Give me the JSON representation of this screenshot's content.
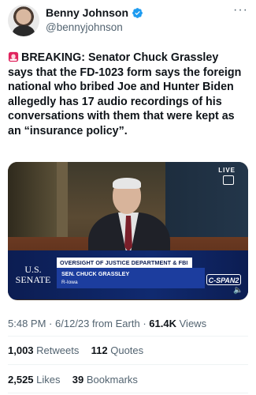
{
  "author": {
    "display_name": "Benny Johnson",
    "handle": "@bennyjohnson",
    "verified_color": "#1d9bf0"
  },
  "tweet": {
    "prefix_icon": "police-siren-emoji",
    "text": "BREAKING: Senator Chuck Grassley says that the FD-1023 form says the foreign national who bribed Joe and Hunter Biden allegedly has 17 audio recordings of his conversations with them that were kept as an “insurance policy”."
  },
  "media": {
    "live_label": "LIVE",
    "senate_label_line1": "U.S.",
    "senate_label_line2": "SENATE",
    "chyron_title": "OVERSIGHT OF JUSTICE DEPARTMENT & FBI",
    "chyron_name": "SEN. CHUCK GRASSLEY",
    "chyron_sub": "R-Iowa",
    "network": "C-SPAN2"
  },
  "meta": {
    "time": "5:48 PM",
    "date": "6/12/23",
    "source": "from Earth",
    "views_count": "61.4K",
    "views_label": "Views"
  },
  "engagement": {
    "retweets_count": "1,003",
    "retweets_label": "Retweets",
    "quotes_count": "112",
    "quotes_label": "Quotes",
    "likes_count": "2,525",
    "likes_label": "Likes",
    "bookmarks_count": "39",
    "bookmarks_label": "Bookmarks"
  }
}
